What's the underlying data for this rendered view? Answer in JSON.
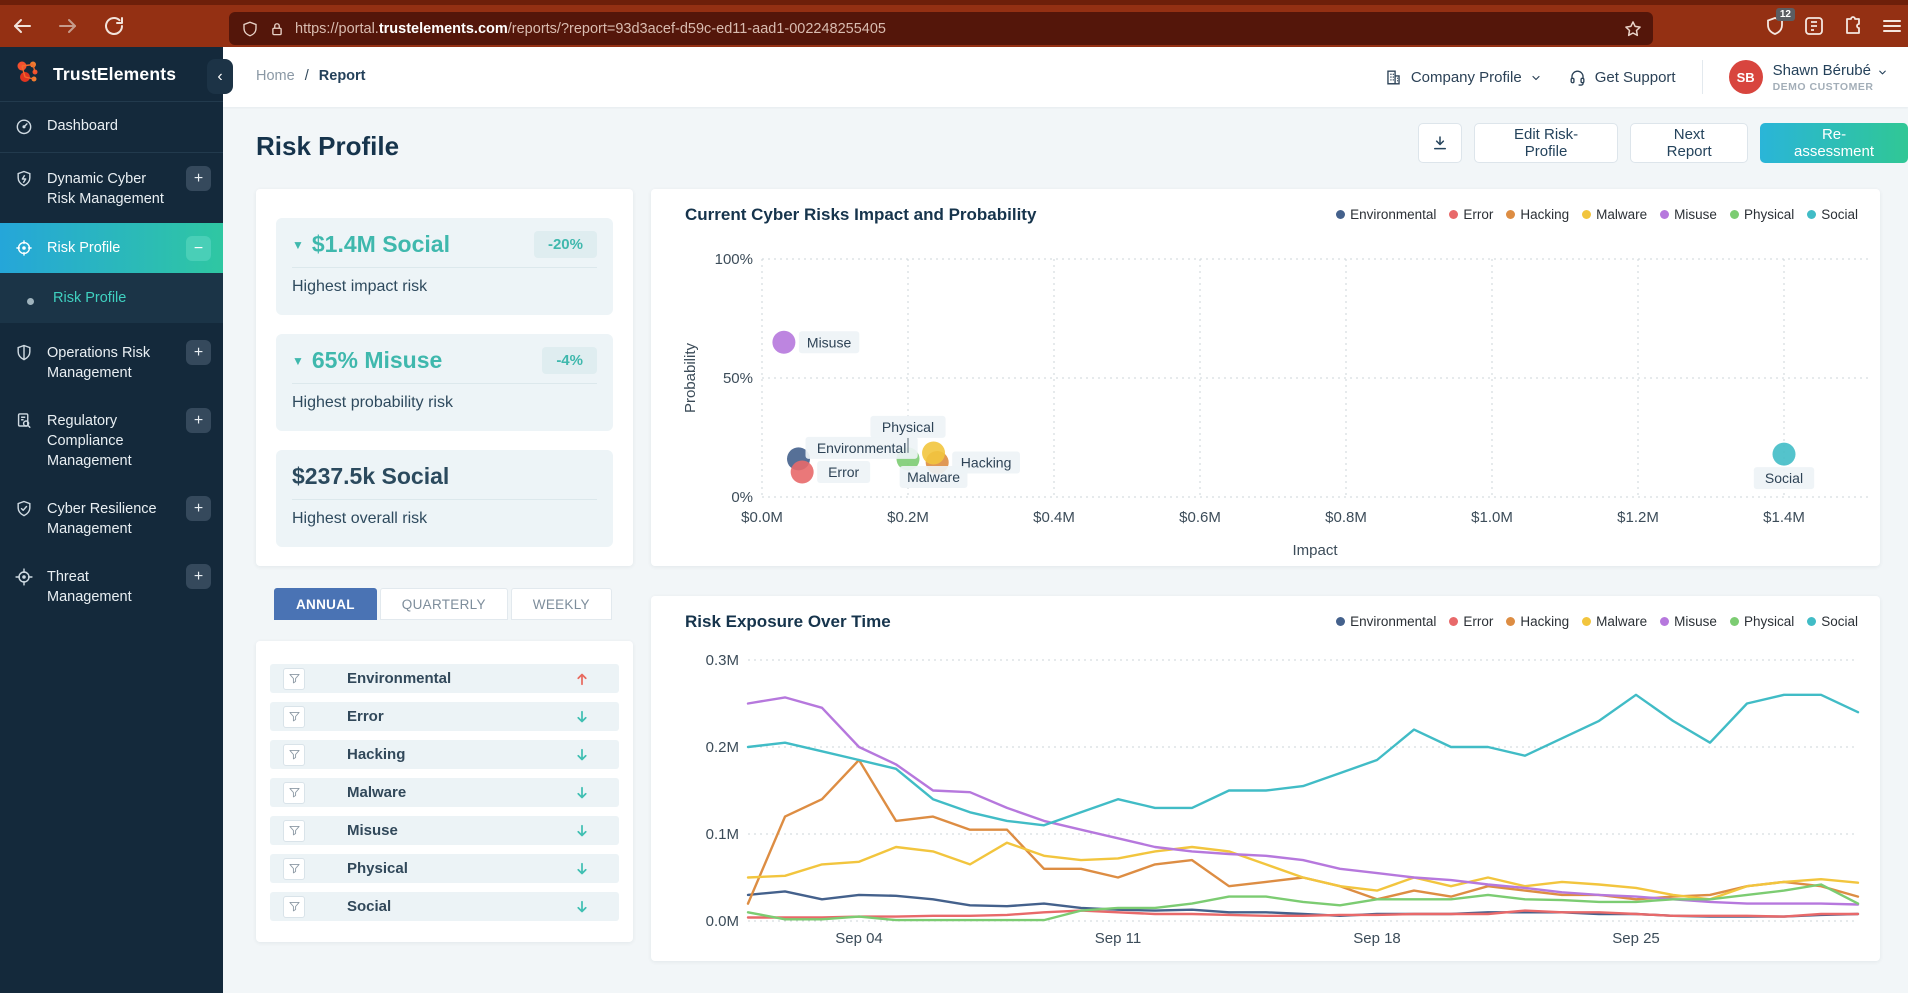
{
  "browser": {
    "url_prefix": "https://portal.",
    "url_domain": "trustelements.com",
    "url_path": "/reports/?report=93d3acef-d59c-ed11-aad1-002248255405",
    "ext_badge": "12"
  },
  "sidebar": {
    "brand": "TrustElements",
    "items": [
      {
        "label": "Dashboard",
        "icon": "gauge",
        "expand": "",
        "active": false,
        "sub": false
      },
      {
        "label": "Dynamic Cyber Risk Management",
        "icon": "shield-bolt",
        "expand": "+",
        "active": false,
        "sub": false
      },
      {
        "label": "Risk Profile",
        "icon": "scope",
        "expand": "−",
        "active": true,
        "sub": false
      },
      {
        "label": "Risk Profile",
        "icon": "dot",
        "expand": "",
        "active": false,
        "sub": true
      },
      {
        "label": "Operations Risk Management",
        "icon": "shield-split",
        "expand": "+",
        "active": false,
        "sub": false
      },
      {
        "label": "Regulatory Compliance Management",
        "icon": "doc-search",
        "expand": "+",
        "active": false,
        "sub": false
      },
      {
        "label": "Cyber Resilience Management",
        "icon": "shield-check",
        "expand": "+",
        "active": false,
        "sub": false
      },
      {
        "label": "Threat Management",
        "icon": "crosshair",
        "expand": "+",
        "active": false,
        "sub": false
      }
    ]
  },
  "header": {
    "breadcrumb": {
      "home": "Home",
      "sep": "/",
      "current": "Report"
    },
    "company_profile": "Company Profile",
    "get_support": "Get Support",
    "user": {
      "initials": "SB",
      "name": "Shawn Bérubé",
      "role": "DEMO CUSTOMER"
    }
  },
  "page": {
    "title": "Risk Profile",
    "buttons": {
      "edit": "Edit Risk-Profile",
      "next": "Next Report",
      "reassess": "Re-assessment"
    }
  },
  "panel": {
    "stats": [
      {
        "value": "$1.4M Social",
        "delta": "-20%",
        "caption": "Highest impact risk",
        "direction": "down",
        "accent": true
      },
      {
        "value": "65% Misuse",
        "delta": "-4%",
        "caption": "Highest probability risk",
        "direction": "down",
        "accent": true
      },
      {
        "value": "$237.5k Social",
        "delta": "",
        "caption": "Highest overall risk",
        "direction": "",
        "accent": false
      }
    ],
    "tabs": [
      "ANNUAL",
      "QUARTERLY",
      "WEEKLY"
    ],
    "active_tab": "ANNUAL",
    "risks": [
      {
        "name": "Environmental",
        "trend": "up"
      },
      {
        "name": "Error",
        "trend": "down"
      },
      {
        "name": "Hacking",
        "trend": "down"
      },
      {
        "name": "Malware",
        "trend": "down"
      },
      {
        "name": "Misuse",
        "trend": "down"
      },
      {
        "name": "Physical",
        "trend": "down"
      },
      {
        "name": "Social",
        "trend": "down"
      }
    ]
  },
  "colors": {
    "Environmental": "#44618c",
    "Error": "#e8696a",
    "Hacking": "#dd8d43",
    "Malware": "#f2c53e",
    "Misuse": "#b678dd",
    "Physical": "#7ccc72",
    "Social": "#41bcc6",
    "accent_teal": "#3fb8ad",
    "trend_up": "#e8695e",
    "trend_down": "#3fbfb2",
    "active_tab_blue": "#4a73b4",
    "avatar_red": "#d8453e"
  },
  "chart_data": [
    {
      "type": "scatter",
      "title": "Current Cyber Risks Impact and Probability",
      "xlabel": "Impact",
      "ylabel": "Probability",
      "x_ticks": [
        "$0.0M",
        "$0.2M",
        "$0.4M",
        "$0.6M",
        "$0.8M",
        "$1.0M",
        "$1.2M",
        "$1.4M"
      ],
      "x_tick_values": [
        0,
        0.2,
        0.4,
        0.6,
        0.8,
        1.0,
        1.2,
        1.4
      ],
      "xlim": [
        0,
        1.52
      ],
      "y_ticks": [
        "0%",
        "50%",
        "100%"
      ],
      "y_tick_values": [
        0,
        50,
        100
      ],
      "ylim": [
        0,
        100
      ],
      "legend": [
        "Environmental",
        "Error",
        "Hacking",
        "Malware",
        "Misuse",
        "Physical",
        "Social"
      ],
      "points": [
        {
          "name": "Misuse",
          "impact_m": 0.03,
          "probability_pct": 65,
          "label_pos": "right"
        },
        {
          "name": "Environmental",
          "impact_m": 0.05,
          "probability_pct": 16,
          "label_pos": "top-right"
        },
        {
          "name": "Error",
          "impact_m": 0.055,
          "probability_pct": 10.5,
          "label_pos": "right"
        },
        {
          "name": "Physical",
          "impact_m": 0.2,
          "probability_pct": 16,
          "label_pos": "top"
        },
        {
          "name": "Hacking",
          "impact_m": 0.24,
          "probability_pct": 14.5,
          "label_pos": "right"
        },
        {
          "name": "Malware",
          "impact_m": 0.235,
          "probability_pct": 18.5,
          "label_pos": "bottom"
        },
        {
          "name": "Social",
          "impact_m": 1.4,
          "probability_pct": 18,
          "label_pos": "bottom"
        }
      ]
    },
    {
      "type": "line",
      "title": "Risk Exposure Over Time",
      "y_ticks": [
        "0.0M",
        "0.1M",
        "0.2M",
        "0.3M"
      ],
      "y_tick_values": [
        0,
        0.1,
        0.2,
        0.3
      ],
      "ylim": [
        0,
        0.3
      ],
      "x_ticks": [
        {
          "label": "Sep 04",
          "index": 3
        },
        {
          "label": "Sep 11",
          "index": 10
        },
        {
          "label": "Sep 18",
          "index": 17
        },
        {
          "label": "Sep 25",
          "index": 24
        }
      ],
      "n_points": 31,
      "legend": [
        "Environmental",
        "Error",
        "Hacking",
        "Malware",
        "Misuse",
        "Physical",
        "Social"
      ],
      "series": [
        {
          "name": "Environmental",
          "values": [
            0.03,
            0.034,
            0.025,
            0.03,
            0.029,
            0.025,
            0.018,
            0.017,
            0.02,
            0.015,
            0.013,
            0.012,
            0.013,
            0.01,
            0.01,
            0.008,
            0.006,
            0.008,
            0.008,
            0.008,
            0.01,
            0.01,
            0.01,
            0.008,
            0.008,
            0.006,
            0.005,
            0.005,
            0.005,
            0.007,
            0.008
          ]
        },
        {
          "name": "Error",
          "values": [
            0.004,
            0.004,
            0.004,
            0.005,
            0.005,
            0.006,
            0.006,
            0.007,
            0.01,
            0.012,
            0.01,
            0.008,
            0.008,
            0.007,
            0.006,
            0.006,
            0.007,
            0.007,
            0.008,
            0.008,
            0.008,
            0.012,
            0.01,
            0.01,
            0.008,
            0.006,
            0.006,
            0.006,
            0.005,
            0.008,
            0.008
          ]
        },
        {
          "name": "Hacking",
          "values": [
            0.02,
            0.12,
            0.14,
            0.185,
            0.115,
            0.12,
            0.105,
            0.105,
            0.06,
            0.06,
            0.05,
            0.065,
            0.07,
            0.04,
            0.045,
            0.05,
            0.04,
            0.025,
            0.035,
            0.028,
            0.04,
            0.035,
            0.03,
            0.03,
            0.025,
            0.028,
            0.03,
            0.04,
            0.045,
            0.04,
            0.028
          ]
        },
        {
          "name": "Malware",
          "values": [
            0.05,
            0.052,
            0.065,
            0.068,
            0.085,
            0.08,
            0.065,
            0.09,
            0.075,
            0.07,
            0.072,
            0.08,
            0.085,
            0.08,
            0.065,
            0.05,
            0.04,
            0.035,
            0.05,
            0.04,
            0.05,
            0.04,
            0.045,
            0.042,
            0.038,
            0.03,
            0.025,
            0.04,
            0.045,
            0.048,
            0.044
          ]
        },
        {
          "name": "Misuse",
          "values": [
            0.25,
            0.257,
            0.245,
            0.2,
            0.18,
            0.15,
            0.148,
            0.13,
            0.115,
            0.105,
            0.095,
            0.085,
            0.08,
            0.077,
            0.075,
            0.07,
            0.06,
            0.055,
            0.05,
            0.047,
            0.042,
            0.038,
            0.033,
            0.03,
            0.028,
            0.025,
            0.022,
            0.02,
            0.02,
            0.02,
            0.019
          ]
        },
        {
          "name": "Physical",
          "values": [
            0.01,
            0.002,
            0.002,
            0.005,
            0.001,
            0.001,
            0.001,
            0.001,
            0.001,
            0.012,
            0.015,
            0.015,
            0.02,
            0.028,
            0.028,
            0.022,
            0.018,
            0.025,
            0.025,
            0.025,
            0.03,
            0.025,
            0.024,
            0.022,
            0.022,
            0.025,
            0.025,
            0.03,
            0.035,
            0.042,
            0.02
          ]
        },
        {
          "name": "Social",
          "values": [
            0.2,
            0.205,
            0.195,
            0.185,
            0.175,
            0.14,
            0.125,
            0.115,
            0.11,
            0.125,
            0.14,
            0.13,
            0.13,
            0.15,
            0.15,
            0.155,
            0.17,
            0.185,
            0.22,
            0.2,
            0.2,
            0.19,
            0.21,
            0.23,
            0.26,
            0.23,
            0.205,
            0.25,
            0.26,
            0.26,
            0.24
          ]
        }
      ]
    }
  ]
}
